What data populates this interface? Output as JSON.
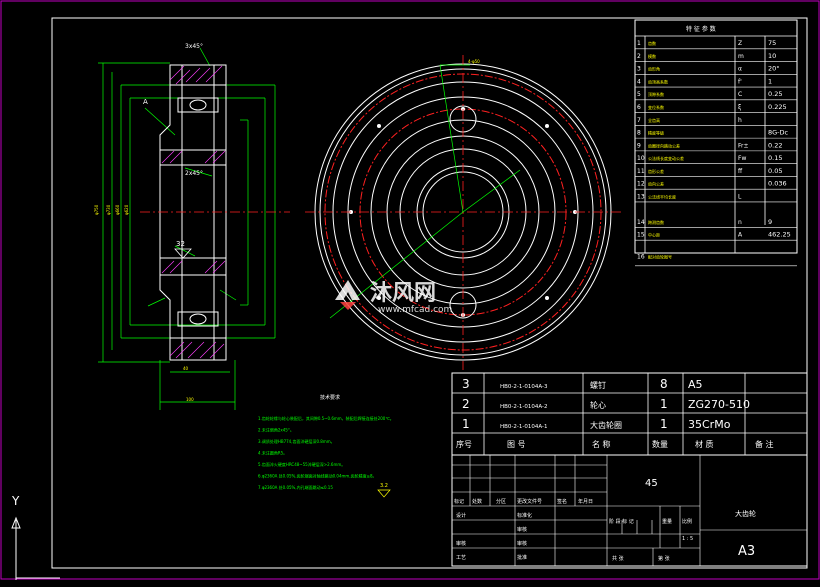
{
  "params_table": {
    "title": "特 征 参 数",
    "rows": [
      {
        "no": "1",
        "name": "齿数",
        "sym": "Z",
        "val": "75"
      },
      {
        "no": "2",
        "name": "模数",
        "sym": "m",
        "val": "10"
      },
      {
        "no": "3",
        "name": "齿形角",
        "sym": "α",
        "val": "20°"
      },
      {
        "no": "4",
        "name": "齿顶高系数",
        "sym": "f'",
        "val": "1"
      },
      {
        "no": "5",
        "name": "顶隙系数",
        "sym": "C",
        "val": "0.25"
      },
      {
        "no": "6",
        "name": "变位系数",
        "sym": "ξ",
        "val": "0.225"
      },
      {
        "no": "7",
        "name": "全齿高",
        "sym": "h",
        "val": ""
      },
      {
        "no": "8",
        "name": "精度等级",
        "sym": "",
        "val": "8G-Dc"
      },
      {
        "no": "9",
        "name": "齿圈径向跳动公差",
        "sym": "Fr±",
        "val": "0.22"
      },
      {
        "no": "10",
        "name": "公法线长度变动公差",
        "sym": "Fw",
        "val": "0.15"
      },
      {
        "no": "11",
        "name": "齿形公差",
        "sym": "ff",
        "val": "0.05"
      },
      {
        "no": "12",
        "name": "齿向公差",
        "sym": "",
        "val": "0.036"
      },
      {
        "no": "13",
        "name": "公法线平均长度",
        "sym": "L",
        "val": ""
      },
      {
        "no": "14",
        "name": "跨测齿数",
        "sym": "n",
        "val": "9"
      },
      {
        "no": "15",
        "name": "中心距",
        "sym": "A",
        "val": "462.25"
      },
      {
        "no": "16",
        "name": "配对齿轮图号",
        "sym": "",
        "val": ""
      }
    ]
  },
  "parts_list": {
    "rows": [
      {
        "no": "3",
        "code": "HB0-2-1-0104A-3",
        "name": "螺钉",
        "qty": "8",
        "material": "A5",
        "note": ""
      },
      {
        "no": "2",
        "code": "HB0-2-1-0104A-2",
        "name": "轮心",
        "qty": "1",
        "material": "ZG270-510",
        "note": ""
      },
      {
        "no": "1",
        "code": "HB0-2-1-0104A-1",
        "name": "大齿轮圈",
        "qty": "1",
        "material": "35CrMo",
        "note": ""
      }
    ],
    "header": {
      "no": "序号",
      "code": "图    号",
      "name": "名    称",
      "qty": "数量",
      "material": "材   质",
      "note": "备   注"
    }
  },
  "title_block": {
    "material": "45",
    "part_name": "大齿轮",
    "sheet_size": "A3",
    "scale": "1 : 5",
    "labels": {
      "mark": "标记",
      "count": "处数",
      "zone": "分区",
      "change_doc": "更改文件号",
      "sign": "签名",
      "date": "年月日",
      "design": "设计",
      "standardize": "标准化",
      "stage_mark": "阶 段 标 记",
      "weight": "重量",
      "ratio": "比例",
      "check": "审核",
      "review": "审核",
      "process": "工艺",
      "approve": "批准",
      "sheets_total": "共   张",
      "sheet_no": "第   张"
    }
  },
  "tech_req": {
    "title": "技术要求",
    "lines": [
      "1.齿轮轮缘与轮心装配后，其间隙0.5~0.6mm，装配后焊接连接处200℃。",
      "2.未注倒角2x45°。",
      "3.调质处理HB774,齿面淬硬层深0.8mm。",
      "4.未注圆角R5。",
      "5.齿面淬火硬度HRC48~55淬硬层深>2.6mm。",
      "6.φ2360A 处0.05%,齿轮端面对轴线跳动0.04mm,齿轮精度≥8。",
      "7.φ2360A 处0.05%,内孔端面跳动≤0.15"
    ]
  },
  "side_view": {
    "chamfer_top": "3x45°",
    "chamfer_mid": "2x45°",
    "label_a": "A",
    "roughness": "32",
    "roughness_side": "3.2"
  },
  "ucs": {
    "y": "Y"
  },
  "watermark": {
    "brand": "沐风网",
    "url": "www.mfcad.com"
  },
  "colors": {
    "bg": "#000000",
    "line": "#ffffff",
    "green": "#00ff00",
    "yellow": "#ffff00",
    "red": "#ff2020",
    "border": "#c000c0",
    "cyan": "#00ffff"
  }
}
